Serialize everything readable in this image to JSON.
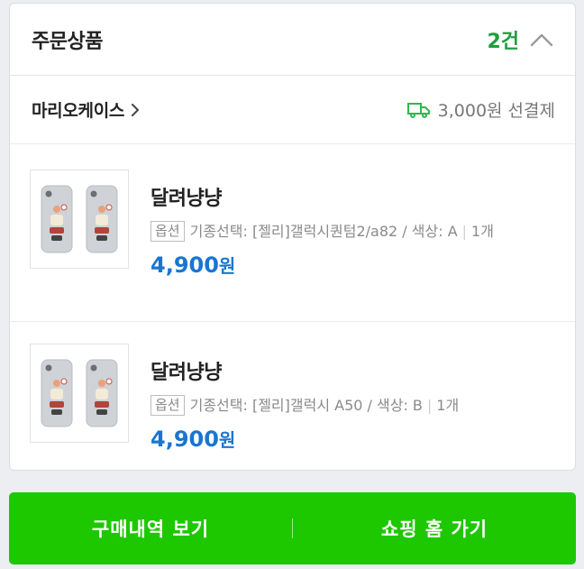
{
  "order_section": {
    "title": "주문상품",
    "count": "2건"
  },
  "seller": {
    "name": "마리오케이스",
    "shipping_fee": "3,000원 선결제"
  },
  "items": [
    {
      "name": "달려냥냥",
      "option_badge": "옵션",
      "option_text": "기종선택: [젤리]갤럭시퀀텀2/a82 / 색상: A",
      "quantity": "1개",
      "price": "4,900",
      "currency": "원"
    },
    {
      "name": "달려냥냥",
      "option_badge": "옵션",
      "option_text": "기종선택: [젤리]갤럭시 A50 / 색상: B",
      "quantity": "1개",
      "price": "4,900",
      "currency": "원"
    }
  ],
  "bottom_bar": {
    "purchase_history_label": "구매내역 보기",
    "go_shopping_home_label": "쇼핑 홈 가기"
  },
  "colors": {
    "accent_green": "#1ec800",
    "count_green": "#1e9e3e",
    "price_blue": "#1a75d1"
  },
  "icons": {
    "collapse": "chevron-up-icon",
    "seller_link": "chevron-right-icon",
    "shipping": "truck-icon"
  }
}
